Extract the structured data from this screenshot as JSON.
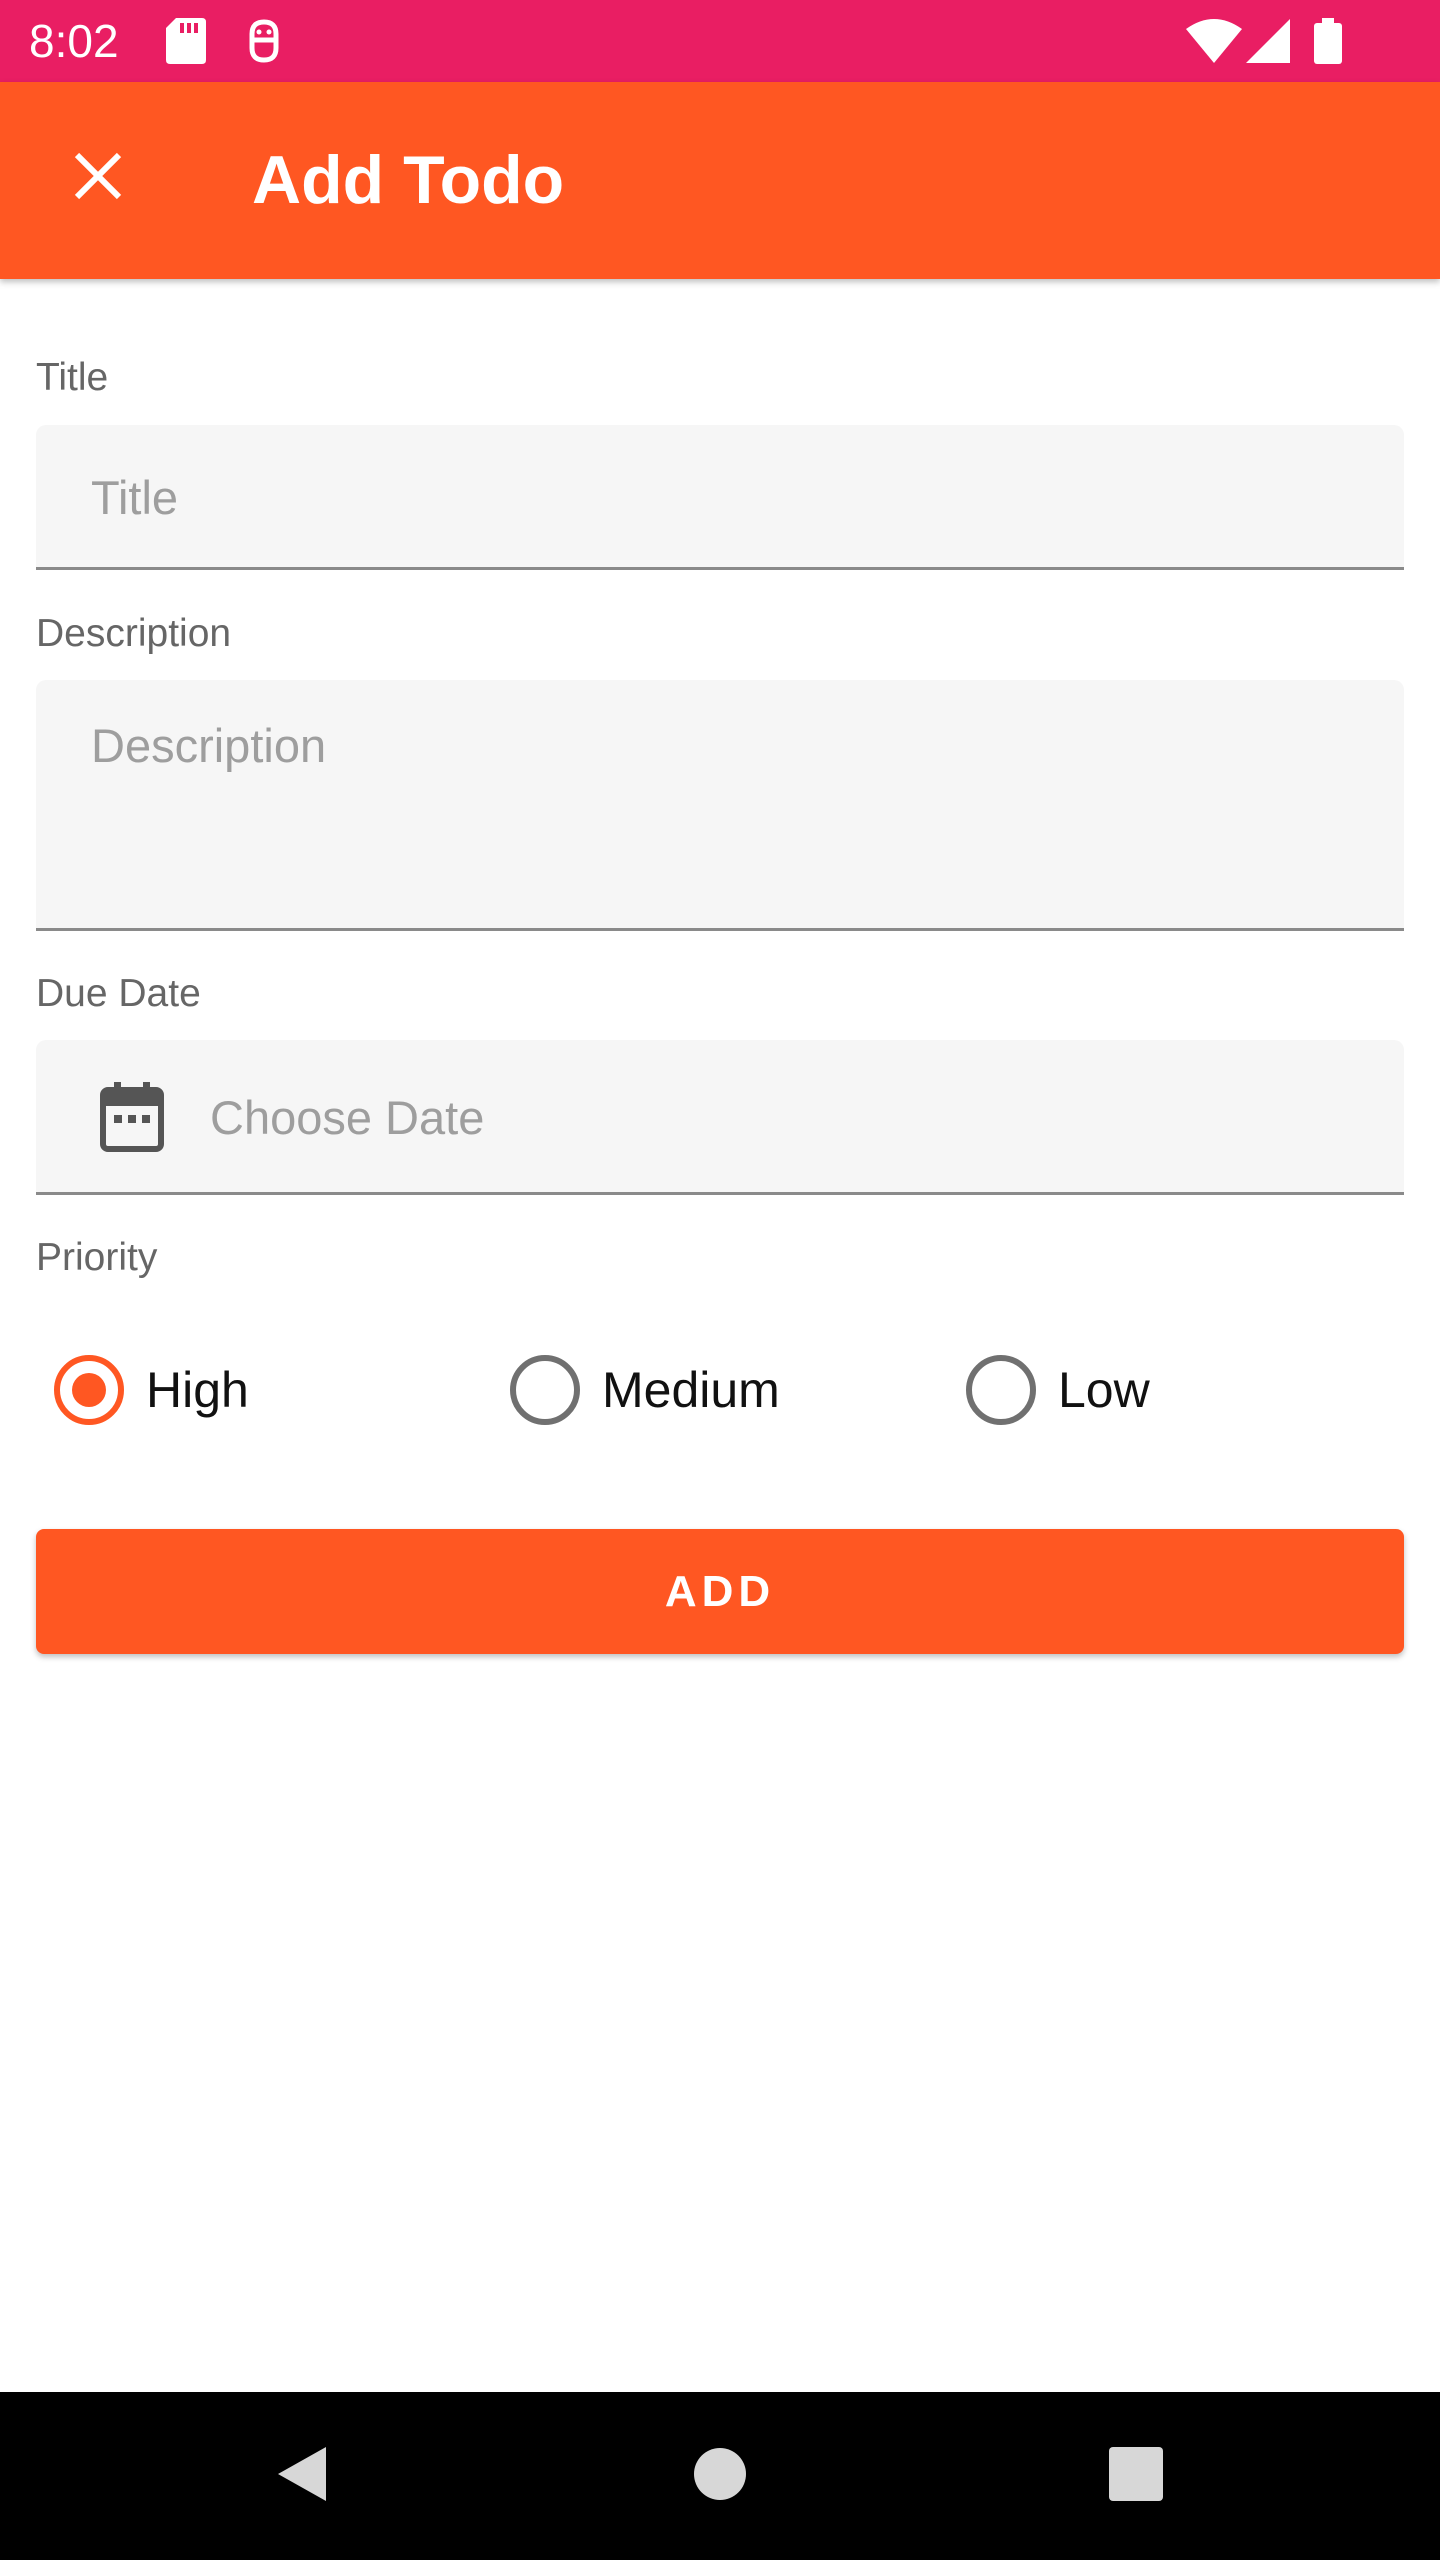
{
  "status_bar": {
    "time": "8:02",
    "background_color": "#E91E63",
    "left_icons": [
      "sd-card-icon",
      "android-debug-icon"
    ],
    "right_icons": [
      "wifi-icon",
      "signal-icon",
      "battery-icon"
    ]
  },
  "app_bar": {
    "title": "Add Todo",
    "nav_icon": "close-icon",
    "background_color": "#FF5722"
  },
  "form": {
    "title": {
      "label": "Title",
      "placeholder": "Title",
      "value": ""
    },
    "description": {
      "label": "Description",
      "placeholder": "Description",
      "value": ""
    },
    "due_date": {
      "label": "Due Date",
      "placeholder": "Choose Date",
      "icon": "calendar-icon",
      "value": ""
    },
    "priority": {
      "label": "Priority",
      "options": [
        {
          "label": "High",
          "selected": true
        },
        {
          "label": "Medium",
          "selected": false
        },
        {
          "label": "Low",
          "selected": false
        }
      ]
    },
    "submit_label": "ADD"
  },
  "nav_bar": {
    "buttons": [
      "back-icon",
      "home-icon",
      "recents-icon"
    ]
  },
  "colors": {
    "accent": "#FF5722",
    "status_bar": "#E91E63",
    "field_background": "#F6F6F6",
    "label_text": "#666666"
  }
}
